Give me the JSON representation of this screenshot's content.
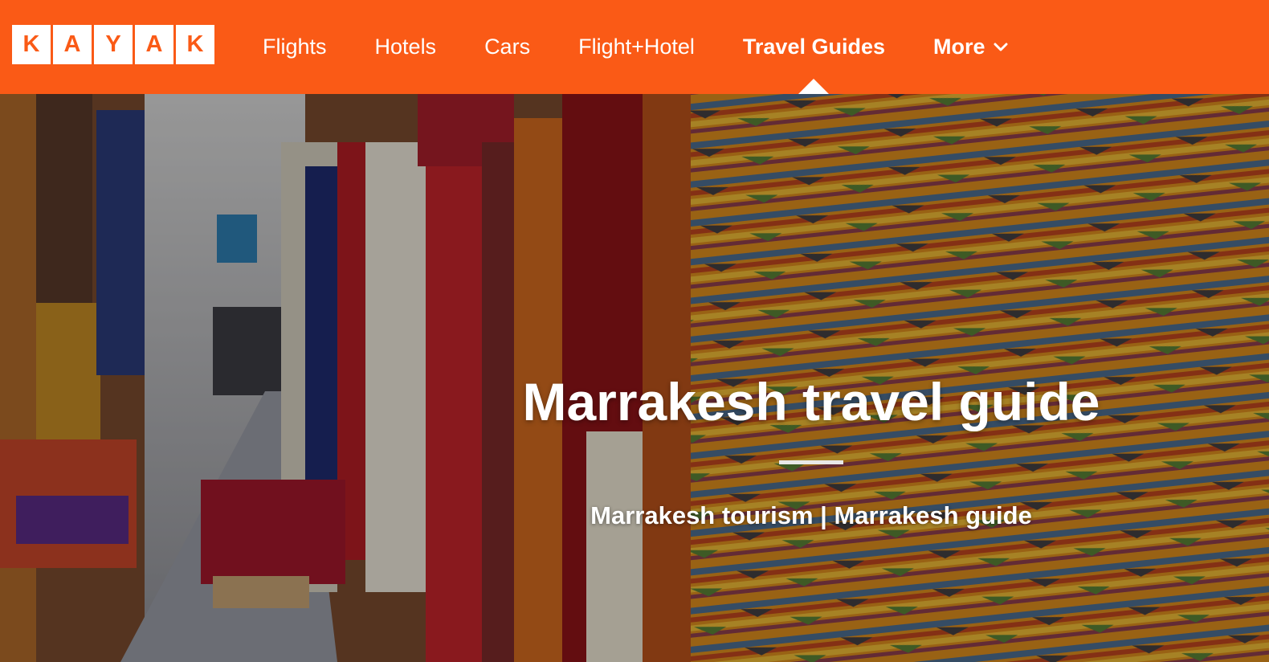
{
  "brand": {
    "logo_letters": [
      "K",
      "A",
      "Y",
      "A",
      "K"
    ],
    "color": "#fa5a16"
  },
  "nav": {
    "items": [
      {
        "label": "Flights"
      },
      {
        "label": "Hotels"
      },
      {
        "label": "Cars"
      },
      {
        "label": "Flight+Hotel"
      },
      {
        "label": "Travel Guides",
        "active": true
      },
      {
        "label": "More",
        "icon": "chevron-down-icon"
      }
    ]
  },
  "hero": {
    "title": "Marrakesh travel guide",
    "link_tourism": "Marrakesh tourism",
    "separator": "|",
    "link_guide": "Marrakesh guide"
  }
}
